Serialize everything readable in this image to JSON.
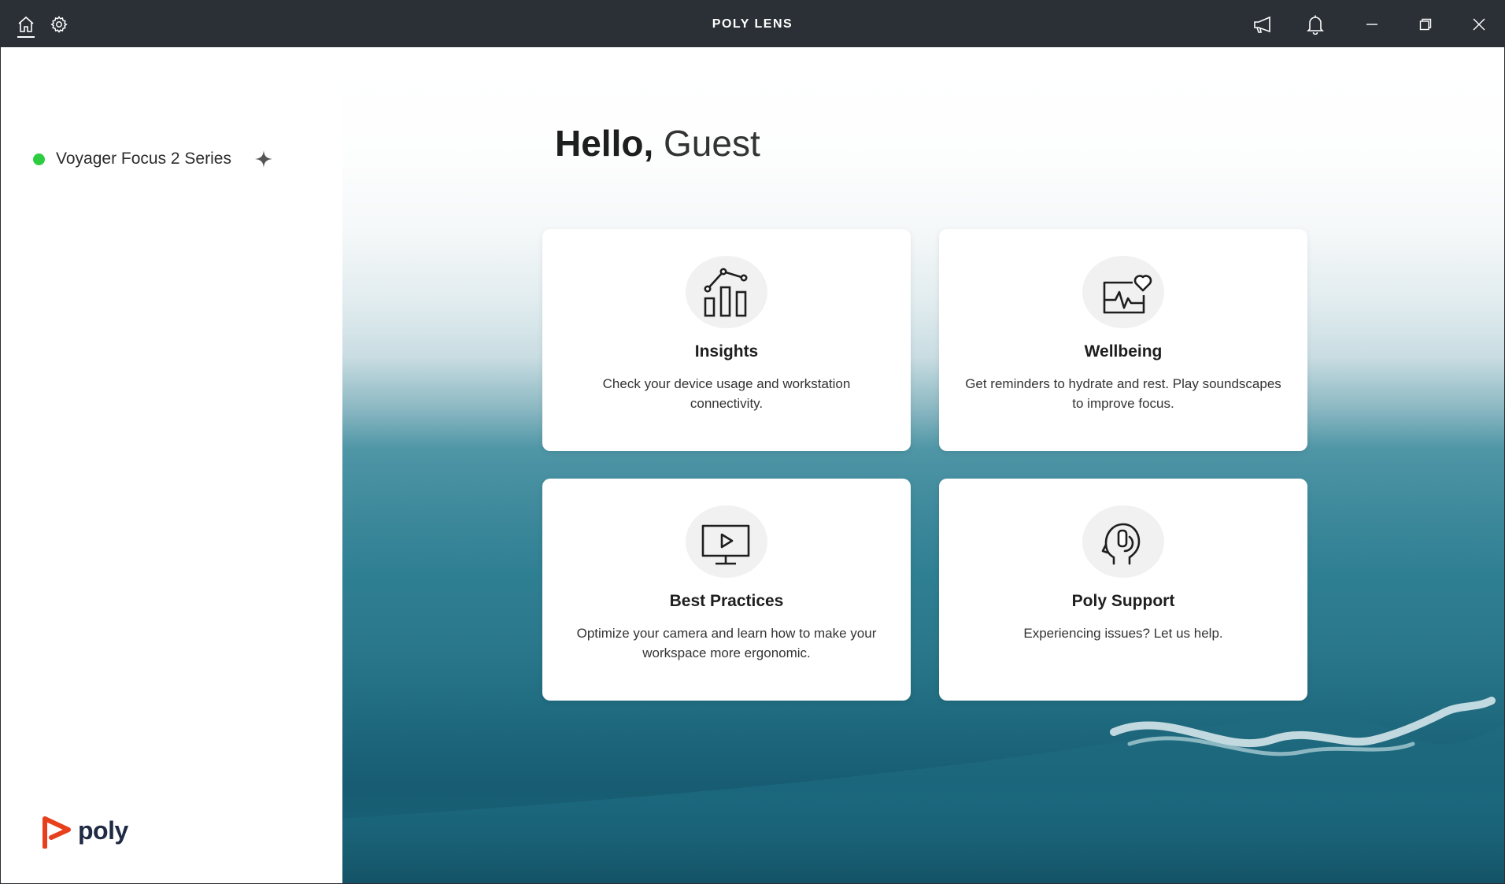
{
  "window": {
    "title": "POLY LENS"
  },
  "titlebar": {
    "home_icon": "home-icon",
    "settings_icon": "gear-icon",
    "announcements_icon": "megaphone-icon",
    "notifications_icon": "bell-icon",
    "minimize_icon": "minimize-icon",
    "maximize_icon": "restore-icon",
    "close_icon": "close-icon"
  },
  "sidebar": {
    "devices": [
      {
        "name": "Voyager Focus 2 Series",
        "status_color": "#2ecc40",
        "action_icon": "sparkle-icon"
      }
    ],
    "logo_text": "poly",
    "logo_color": "#e8401c"
  },
  "main": {
    "greeting_hello": "Hello,",
    "greeting_name": "Guest",
    "cards": [
      {
        "title": "Insights",
        "description": "Check your device usage and workstation connectivity.",
        "icon": "chart-icon"
      },
      {
        "title": "Wellbeing",
        "description": "Get reminders to hydrate and rest. Play soundscapes to improve focus.",
        "icon": "heart-monitor-icon"
      },
      {
        "title": "Best Practices",
        "description": "Optimize your camera and learn how to make your workspace more ergonomic.",
        "icon": "video-monitor-icon"
      },
      {
        "title": "Poly Support",
        "description": "Experiencing issues? Let us help.",
        "icon": "headset-support-icon"
      }
    ]
  },
  "colors": {
    "titlebar_bg": "#2a3036",
    "accent": "#e8401c",
    "status_connected": "#2ecc40"
  }
}
